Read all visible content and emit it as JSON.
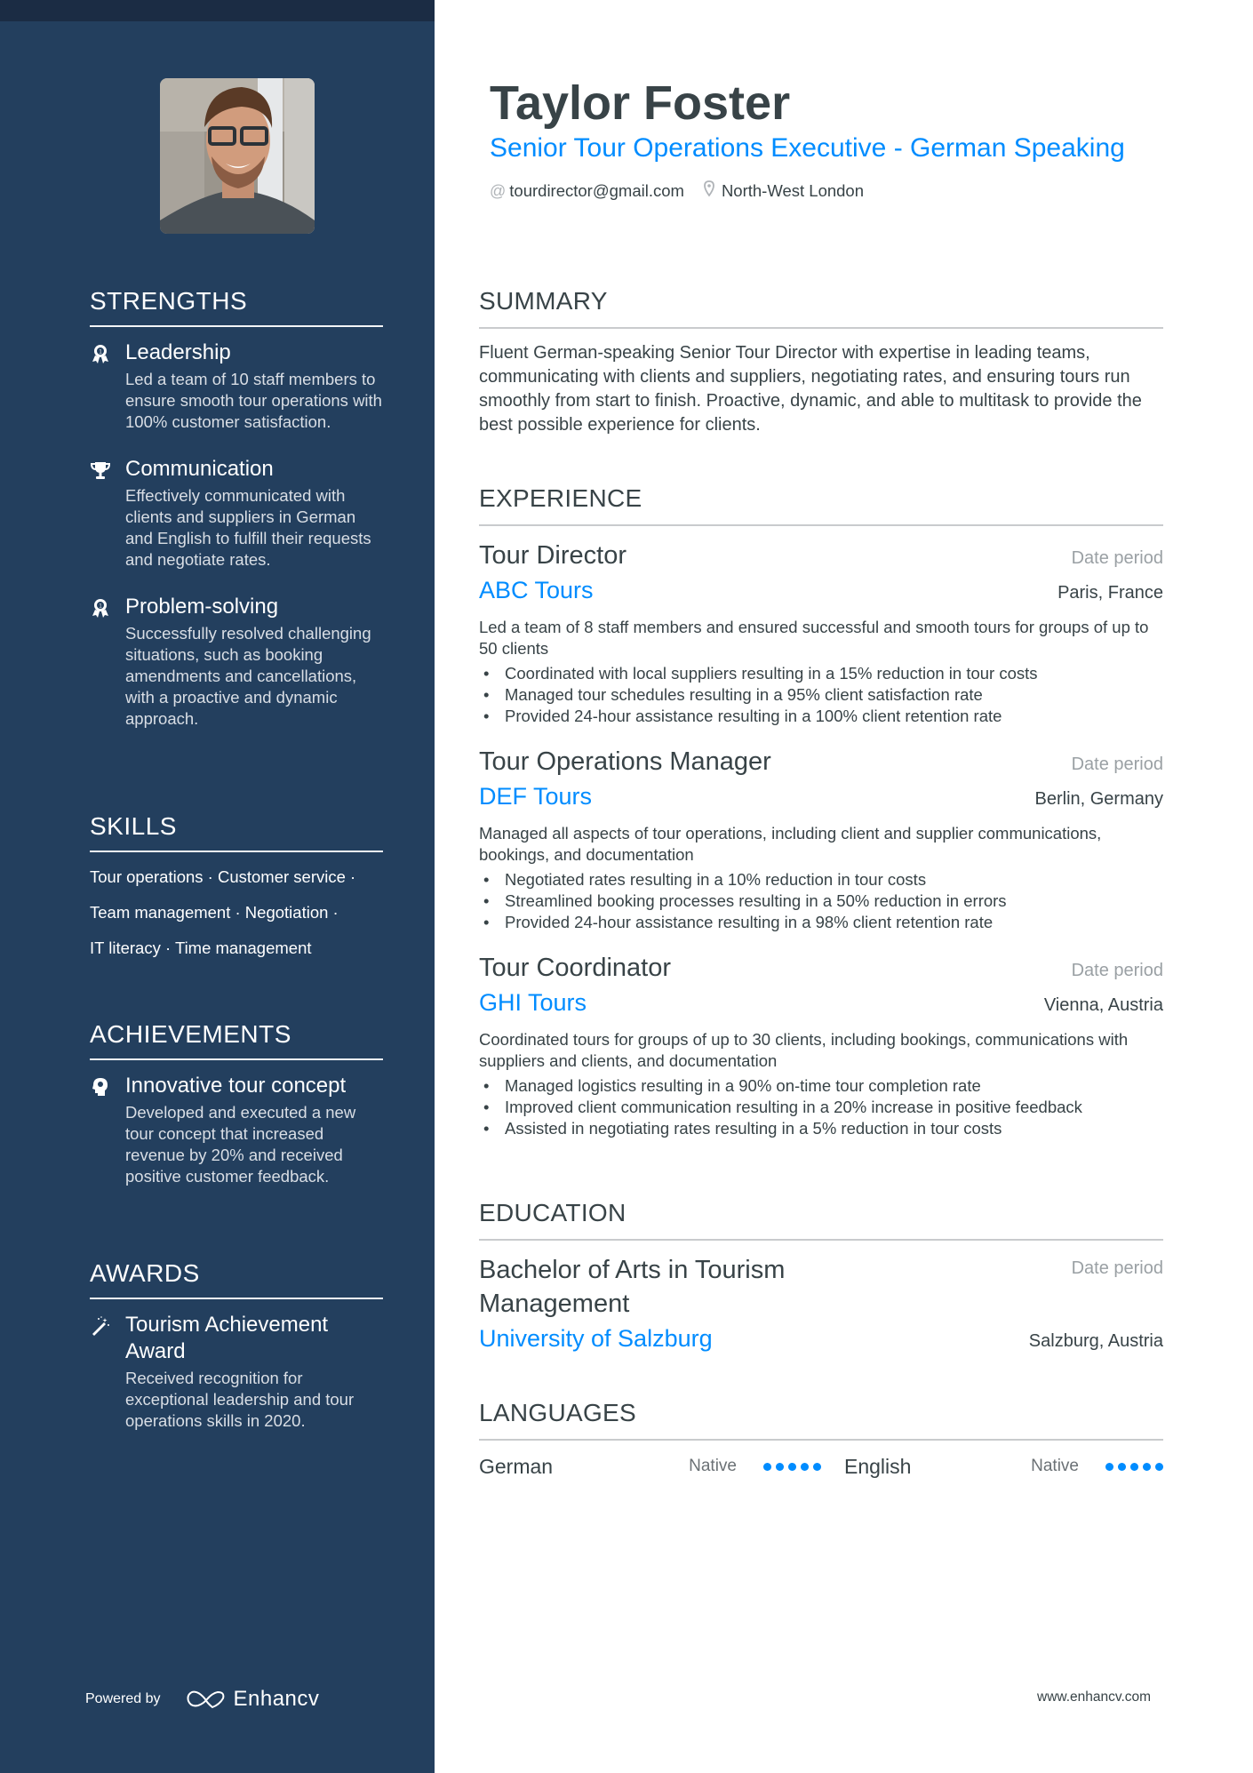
{
  "header": {
    "name": "Taylor Foster",
    "title": "Senior Tour Operations Executive - German Speaking",
    "email": "tourdirector@gmail.com",
    "location": "North-West London",
    "email_icon": "at-icon",
    "location_icon": "map-pin-icon"
  },
  "colors": {
    "sidebar": "#233f5e",
    "sidebar_topband": "#1b2c44",
    "accent": "#008cff",
    "text": "#384347",
    "muted": "#9aa0a4"
  },
  "sidebar": {
    "strengths": {
      "title": "STRENGTHS",
      "items": [
        {
          "icon": "award-ribbon-icon",
          "title": "Leadership",
          "desc": "Led a team of 10 staff members to ensure smooth tour operations with 100% customer satisfaction."
        },
        {
          "icon": "trophy-icon",
          "title": "Communication",
          "desc": "Effectively communicated with clients and suppliers in German and English to fulfill their requests and negotiate rates."
        },
        {
          "icon": "award-ribbon-icon",
          "title": "Problem-solving",
          "desc": "Successfully resolved challenging situations, such as booking amendments and cancellations, with a proactive and dynamic approach."
        }
      ]
    },
    "skills": {
      "title": "SKILLS",
      "lines": [
        "Tour operations · Customer service ·",
        "Team management · Negotiation ·",
        "IT literacy · Time management"
      ]
    },
    "achievements": {
      "title": "ACHIEVEMENTS",
      "items": [
        {
          "icon": "head-idea-icon",
          "title": "Innovative tour concept",
          "desc": "Developed and executed a new tour concept that increased revenue by 20% and received positive customer feedback."
        }
      ]
    },
    "awards": {
      "title": "AWARDS",
      "items": [
        {
          "icon": "magic-wand-icon",
          "title": "Tourism Achievement Award",
          "desc": "Received recognition for exceptional leadership and tour operations skills in 2020."
        }
      ]
    },
    "footer": {
      "powered_by": "Powered by",
      "brand": "Enhancv"
    }
  },
  "summary": {
    "title": "SUMMARY",
    "text": "Fluent German-speaking Senior Tour Director with expertise in leading teams, communicating with clients and suppliers, negotiating rates, and ensuring tours run smoothly from start to finish. Proactive, dynamic, and able to multitask to provide the best possible experience for clients."
  },
  "experience": {
    "title": "EXPERIENCE",
    "items": [
      {
        "role": "Tour Director",
        "date": "Date period",
        "company": "ABC Tours",
        "location": "Paris, France",
        "desc": "Led a team of 8 staff members and ensured successful and smooth tours for groups of up to 50 clients",
        "bullets": [
          "Coordinated with local suppliers resulting in a 15% reduction in tour costs",
          "Managed tour schedules resulting in a 95% client satisfaction rate",
          "Provided 24-hour assistance resulting in a 100% client retention rate"
        ]
      },
      {
        "role": "Tour Operations Manager",
        "date": "Date period",
        "company": "DEF Tours",
        "location": "Berlin, Germany",
        "desc": "Managed all aspects of tour operations, including client and supplier communications, bookings, and documentation",
        "bullets": [
          "Negotiated rates resulting in a 10% reduction in tour costs",
          "Streamlined booking processes resulting in a 50% reduction in errors",
          "Provided 24-hour assistance resulting in a 98% client retention rate"
        ]
      },
      {
        "role": "Tour Coordinator",
        "date": "Date period",
        "company": "GHI Tours",
        "location": "Vienna, Austria",
        "desc": "Coordinated tours for groups of up to 30 clients, including bookings, communications with suppliers and clients, and documentation",
        "bullets": [
          "Managed logistics resulting in a 90% on-time tour completion rate",
          "Improved client communication resulting in a 20% increase in positive feedback",
          "Assisted in negotiating rates resulting in a 5% reduction in tour costs"
        ]
      }
    ]
  },
  "education": {
    "title": "EDUCATION",
    "items": [
      {
        "degree": "Bachelor of Arts in Tourism Management",
        "date": "Date period",
        "school": "University of Salzburg",
        "location": "Salzburg, Austria"
      }
    ]
  },
  "languages": {
    "title": "LANGUAGES",
    "items": [
      {
        "name": "German",
        "level": "Native",
        "rating": 5,
        "max": 5
      },
      {
        "name": "English",
        "level": "Native",
        "rating": 5,
        "max": 5
      }
    ]
  },
  "footer": {
    "website": "www.enhancv.com"
  }
}
